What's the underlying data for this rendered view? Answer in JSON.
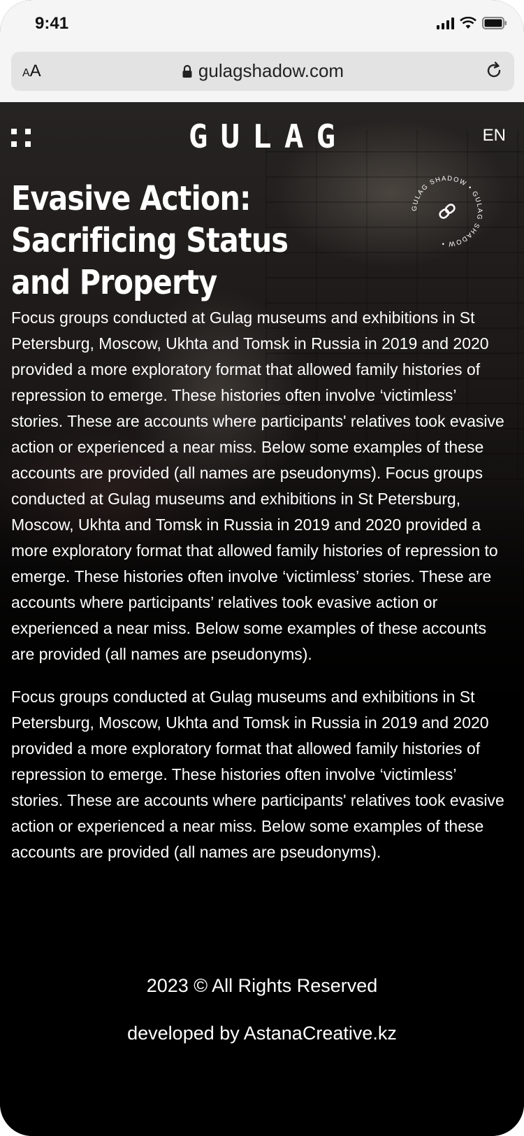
{
  "status_bar": {
    "time": "9:41"
  },
  "browser": {
    "aa_label_small": "A",
    "aa_label_big": "A",
    "url": "gulagshadow.com"
  },
  "header": {
    "logo": "GULAG",
    "language": "EN"
  },
  "badge": {
    "ring_text": "GULAG SHADOW • GULAG SHADOW •"
  },
  "article": {
    "title": "Evasive Action: Sacrificing Status and Property",
    "paragraphs": [
      "Focus groups conducted at Gulag museums and exhibitions in St Petersburg, Moscow, Ukhta and Tomsk in Russia in 2019 and 2020 provided a more exploratory format that allowed family histories of repression to emerge. These histories often involve ‘victimless’ stories. These are accounts where participants' relatives took evasive action or experienced a near miss. Below some examples of these accounts are provided (all names are pseudonyms). Focus groups conducted at Gulag museums and exhibitions in St Petersburg, Moscow, Ukhta and Tomsk in Russia in 2019 and 2020 provided a more exploratory format that allowed family histories of repression to emerge. These histories often involve ‘victimless’ stories. These are accounts where participants’ relatives took evasive action or experienced a near miss. Below some examples of these accounts are provided (all names are pseudonyms).",
      "Focus groups conducted at Gulag museums and exhibitions in St Petersburg, Moscow, Ukhta and Tomsk in Russia in 2019 and 2020 provided a more exploratory format that allowed family histories of repression to emerge. These histories often involve ‘victimless’ stories. These are accounts where participants' relatives took evasive action or experienced a near miss. Below some examples of these accounts are provided (all names are pseudonyms)."
    ]
  },
  "footer": {
    "rights": "2023 © All Rights Reserved",
    "developer": "developed by AstanaCreative.kz"
  }
}
